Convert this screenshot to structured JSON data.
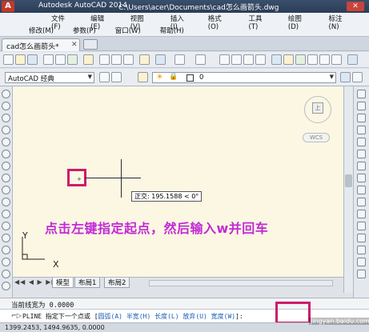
{
  "titlebar": {
    "app_title": "Autodesk AutoCAD 2014",
    "file_path": "C:\\Users\\acer\\Documents\\cad怎么画箭头.dwg",
    "logo_letter": "A",
    "close_label": "✕"
  },
  "menus": {
    "row1": [
      "文件(F)",
      "编辑(E)",
      "视图(V)",
      "插入(I)",
      "格式(O)",
      "工具(T)",
      "绘图(D)",
      "标注(N)"
    ],
    "row2": [
      "修改(M)",
      "参数(P)",
      "窗口(W)",
      "帮助(H)"
    ]
  },
  "tabs": {
    "document_tab": "cad怎么画箭头*",
    "close_glyph": "✕"
  },
  "toolbar": {
    "workspace_value": "AutoCAD 经典",
    "layer_value": "0"
  },
  "canvas": {
    "viewcube_face": "上",
    "wcs_label": "WCS",
    "ortho_tooltip": "正交: 195.1588 < 0°",
    "instruction": "点击左键指定起点，然后输入w并回车",
    "ucs_y": "Y",
    "ucs_x": "X",
    "background_color": "#fbf7e3",
    "annotation_color": "#cc1d6a",
    "instruction_color": "#c12ad6"
  },
  "layout_tabs": {
    "nav": "◀◀ ◀ ▶ ▶▶",
    "model": "模型",
    "layout1": "布局1",
    "layout2": "布局2"
  },
  "command": {
    "history": "当前线宽为 0.0000",
    "prompt_icon": "⌐▷",
    "prefix": "PLINE 指定下一个点或 [",
    "options": [
      "圆弧(A)",
      "半宽(H)",
      "长度(L)",
      "放弃(U)",
      "宽度(W)"
    ],
    "suffix": "]:"
  },
  "status": {
    "coords": "1399.2453, 1494.9635, 0.0000"
  },
  "watermark": "jingyan.baidu.com"
}
